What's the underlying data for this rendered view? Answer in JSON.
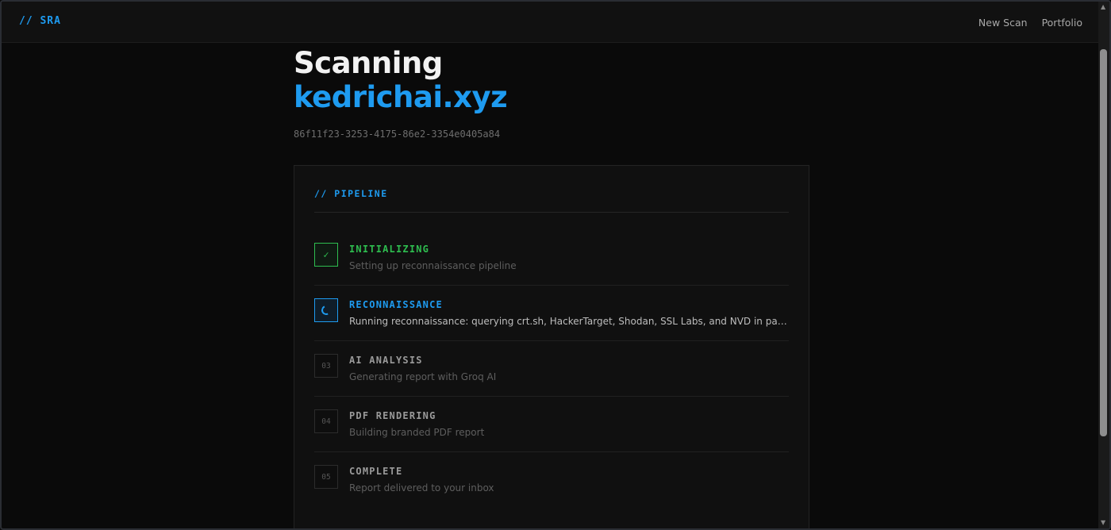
{
  "nav": {
    "brand": "// SRA",
    "links": [
      "New Scan",
      "Portfolio"
    ]
  },
  "header": {
    "title": "Scanning",
    "domain": "kedrichai.xyz",
    "scan_id": "86f11f23-3253-4175-86e2-3354e0405a84"
  },
  "pipeline": {
    "title": "// PIPELINE",
    "steps": [
      {
        "marker": "✓",
        "label": "INITIALIZING",
        "desc": "Setting up reconnaissance pipeline",
        "state": "done"
      },
      {
        "marker": "",
        "label": "RECONNAISSANCE",
        "desc": "Running reconnaissance: querying crt.sh, HackerTarget, Shodan, SSL Labs, and NVD in parallel...",
        "state": "active"
      },
      {
        "marker": "03",
        "label": "AI ANALYSIS",
        "desc": "Generating report with Groq AI",
        "state": "pending"
      },
      {
        "marker": "04",
        "label": "PDF RENDERING",
        "desc": "Building branded PDF report",
        "state": "pending"
      },
      {
        "marker": "05",
        "label": "COMPLETE",
        "desc": "Report delivered to your inbox",
        "state": "pending"
      }
    ]
  },
  "colors": {
    "accent": "#1e9bf0",
    "success": "#2ebd4f",
    "background": "#0a0a0a"
  }
}
